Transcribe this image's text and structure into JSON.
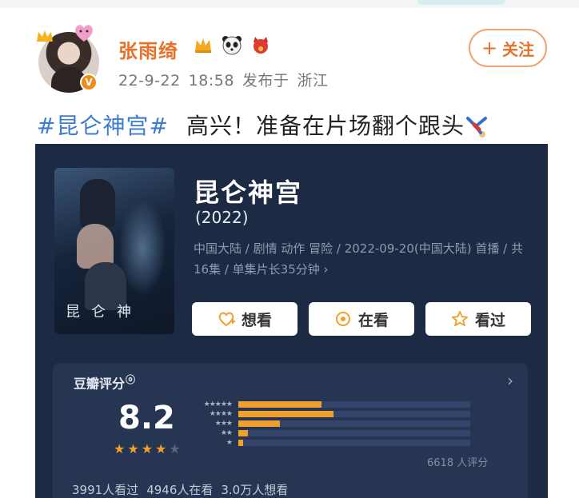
{
  "post": {
    "username": "张雨绮",
    "date": "22-9-22",
    "time": "18:58",
    "published_label": "发布于",
    "location": "浙江",
    "follow_label": "关注",
    "topic": "#昆仑神宫#",
    "text": "高兴！准备在片场翻个跟头",
    "badges": [
      "crown-icon",
      "panda-icon",
      "lucky-cat-icon"
    ],
    "verified": "V"
  },
  "card": {
    "poster_title": "昆仑神",
    "title": "昆仑神宫",
    "year": "(2022)",
    "info": "中国大陆 / 剧情 动作 冒险 / 2022-09-20(中国大陆) 首播 / 共16集 / 单集片长35分钟 ›",
    "actions": {
      "want": "想看",
      "watching": "在看",
      "watched": "看过"
    },
    "rating": {
      "label": "豆瓣评分",
      "score": "8.2",
      "stars_filled": 4,
      "stars_total": 5,
      "distribution": [
        {
          "stars": "★★★★★",
          "value": 0.36
        },
        {
          "stars": "★★★★",
          "value": 0.41
        },
        {
          "stars": "★★★",
          "value": 0.18
        },
        {
          "stars": "★★",
          "value": 0.04
        },
        {
          "stars": "★",
          "value": 0.02
        }
      ],
      "raters": "6618 人评分"
    },
    "stats": {
      "watched": "3991人看过",
      "watching": "4946人在看",
      "want": "3.0万人想看"
    }
  },
  "colors": {
    "username": "#e8712a",
    "topic": "#3b7bd1",
    "card_bg": "#1d2a44",
    "bar": "#f2a02d",
    "star": "#f2a02d"
  }
}
